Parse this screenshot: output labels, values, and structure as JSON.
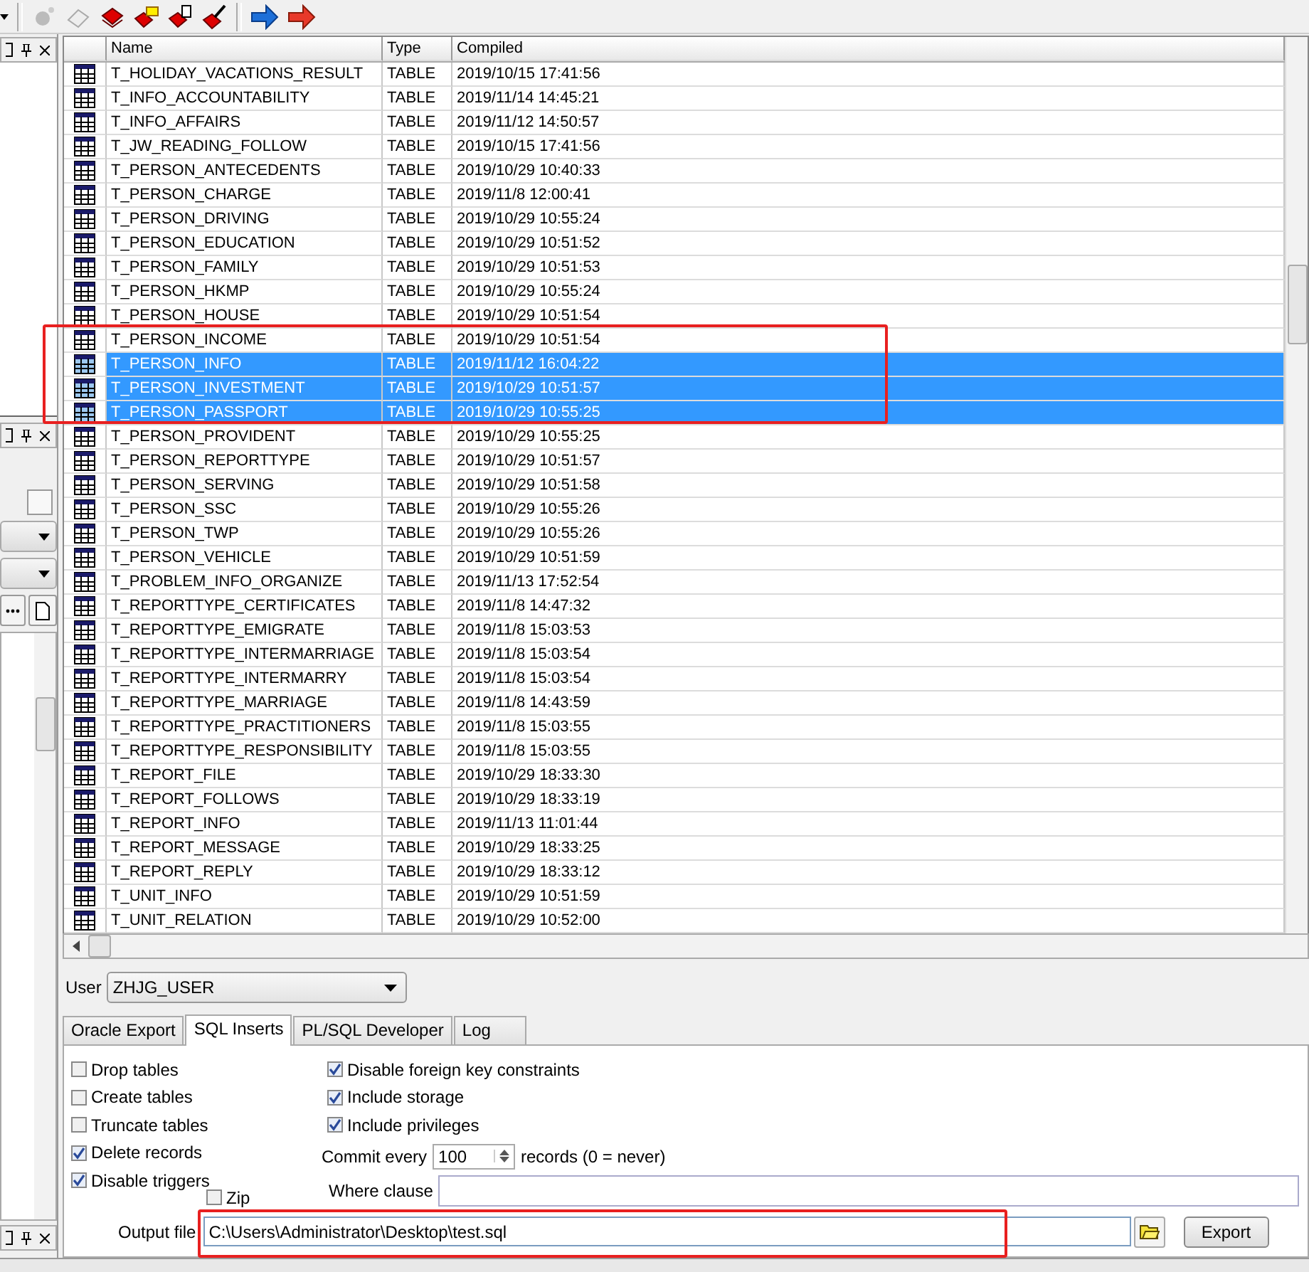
{
  "table": {
    "columns": [
      "Name",
      "Type",
      "Compiled"
    ],
    "rows": [
      {
        "name": "T_HOLIDAY_VACATIONS_RESULT",
        "type": "TABLE",
        "compiled": "2019/10/15 17:41:56",
        "selected": false
      },
      {
        "name": "T_INFO_ACCOUNTABILITY",
        "type": "TABLE",
        "compiled": "2019/11/14 14:45:21",
        "selected": false
      },
      {
        "name": "T_INFO_AFFAIRS",
        "type": "TABLE",
        "compiled": "2019/11/12 14:50:57",
        "selected": false
      },
      {
        "name": "T_JW_READING_FOLLOW",
        "type": "TABLE",
        "compiled": "2019/10/15 17:41:56",
        "selected": false
      },
      {
        "name": "T_PERSON_ANTECEDENTS",
        "type": "TABLE",
        "compiled": "2019/10/29 10:40:33",
        "selected": false
      },
      {
        "name": "T_PERSON_CHARGE",
        "type": "TABLE",
        "compiled": "2019/11/8 12:00:41",
        "selected": false
      },
      {
        "name": "T_PERSON_DRIVING",
        "type": "TABLE",
        "compiled": "2019/10/29 10:55:24",
        "selected": false
      },
      {
        "name": "T_PERSON_EDUCATION",
        "type": "TABLE",
        "compiled": "2019/10/29 10:51:52",
        "selected": false
      },
      {
        "name": "T_PERSON_FAMILY",
        "type": "TABLE",
        "compiled": "2019/10/29 10:51:53",
        "selected": false
      },
      {
        "name": "T_PERSON_HKMP",
        "type": "TABLE",
        "compiled": "2019/10/29 10:55:24",
        "selected": false
      },
      {
        "name": "T_PERSON_HOUSE",
        "type": "TABLE",
        "compiled": "2019/10/29 10:51:54",
        "selected": false
      },
      {
        "name": "T_PERSON_INCOME",
        "type": "TABLE",
        "compiled": "2019/10/29 10:51:54",
        "selected": false
      },
      {
        "name": "T_PERSON_INFO",
        "type": "TABLE",
        "compiled": "2019/11/12 16:04:22",
        "selected": true
      },
      {
        "name": "T_PERSON_INVESTMENT",
        "type": "TABLE",
        "compiled": "2019/10/29 10:51:57",
        "selected": true
      },
      {
        "name": "T_PERSON_PASSPORT",
        "type": "TABLE",
        "compiled": "2019/10/29 10:55:25",
        "selected": true
      },
      {
        "name": "T_PERSON_PROVIDENT",
        "type": "TABLE",
        "compiled": "2019/10/29 10:55:25",
        "selected": false
      },
      {
        "name": "T_PERSON_REPORTTYPE",
        "type": "TABLE",
        "compiled": "2019/10/29 10:51:57",
        "selected": false
      },
      {
        "name": "T_PERSON_SERVING",
        "type": "TABLE",
        "compiled": "2019/10/29 10:51:58",
        "selected": false
      },
      {
        "name": "T_PERSON_SSC",
        "type": "TABLE",
        "compiled": "2019/10/29 10:55:26",
        "selected": false
      },
      {
        "name": "T_PERSON_TWP",
        "type": "TABLE",
        "compiled": "2019/10/29 10:55:26",
        "selected": false
      },
      {
        "name": "T_PERSON_VEHICLE",
        "type": "TABLE",
        "compiled": "2019/10/29 10:51:59",
        "selected": false
      },
      {
        "name": "T_PROBLEM_INFO_ORGANIZE",
        "type": "TABLE",
        "compiled": "2019/11/13 17:52:54",
        "selected": false
      },
      {
        "name": "T_REPORTTYPE_CERTIFICATES",
        "type": "TABLE",
        "compiled": "2019/11/8 14:47:32",
        "selected": false
      },
      {
        "name": "T_REPORTTYPE_EMIGRATE",
        "type": "TABLE",
        "compiled": "2019/11/8 15:03:53",
        "selected": false
      },
      {
        "name": "T_REPORTTYPE_INTERMARRIAGE",
        "type": "TABLE",
        "compiled": "2019/11/8 15:03:54",
        "selected": false
      },
      {
        "name": "T_REPORTTYPE_INTERMARRY",
        "type": "TABLE",
        "compiled": "2019/11/8 15:03:54",
        "selected": false
      },
      {
        "name": "T_REPORTTYPE_MARRIAGE",
        "type": "TABLE",
        "compiled": "2019/11/8 14:43:59",
        "selected": false
      },
      {
        "name": "T_REPORTTYPE_PRACTITIONERS",
        "type": "TABLE",
        "compiled": "2019/11/8 15:03:55",
        "selected": false
      },
      {
        "name": "T_REPORTTYPE_RESPONSIBILITY",
        "type": "TABLE",
        "compiled": "2019/11/8 15:03:55",
        "selected": false
      },
      {
        "name": "T_REPORT_FILE",
        "type": "TABLE",
        "compiled": "2019/10/29 18:33:30",
        "selected": false
      },
      {
        "name": "T_REPORT_FOLLOWS",
        "type": "TABLE",
        "compiled": "2019/10/29 18:33:19",
        "selected": false
      },
      {
        "name": "T_REPORT_INFO",
        "type": "TABLE",
        "compiled": "2019/11/13 11:01:44",
        "selected": false
      },
      {
        "name": "T_REPORT_MESSAGE",
        "type": "TABLE",
        "compiled": "2019/10/29 18:33:25",
        "selected": false
      },
      {
        "name": "T_REPORT_REPLY",
        "type": "TABLE",
        "compiled": "2019/10/29 18:33:12",
        "selected": false
      },
      {
        "name": "T_UNIT_INFO",
        "type": "TABLE",
        "compiled": "2019/10/29 10:51:59",
        "selected": false
      },
      {
        "name": "T_UNIT_RELATION",
        "type": "TABLE",
        "compiled": "2019/10/29 10:52:00",
        "selected": false
      }
    ]
  },
  "user": {
    "label": "User",
    "value": "ZHJG_USER"
  },
  "tabs": [
    {
      "label": "Oracle Export",
      "selected": false
    },
    {
      "label": "SQL Inserts",
      "selected": true
    },
    {
      "label": "PL/SQL Developer",
      "selected": false
    },
    {
      "label": "Log",
      "selected": false
    }
  ],
  "options_left": [
    {
      "label": "Drop tables",
      "checked": false
    },
    {
      "label": "Create tables",
      "checked": false
    },
    {
      "label": "Truncate tables",
      "checked": false
    },
    {
      "label": "Delete records",
      "checked": true
    },
    {
      "label": "Disable triggers",
      "checked": true
    }
  ],
  "options_right": [
    {
      "label": "Disable foreign key constraints",
      "checked": true
    },
    {
      "label": "Include storage",
      "checked": true
    },
    {
      "label": "Include privileges",
      "checked": true
    }
  ],
  "commit": {
    "label": "Commit every",
    "value": "100",
    "suffix": "records (0 = never)"
  },
  "where_clause": {
    "label": "Where clause"
  },
  "zip": {
    "label": "Zip",
    "checked": false
  },
  "output_file": {
    "label": "Output file",
    "value": "C:\\Users\\Administrator\\Desktop\\test.sql"
  },
  "export_button": "Export"
}
